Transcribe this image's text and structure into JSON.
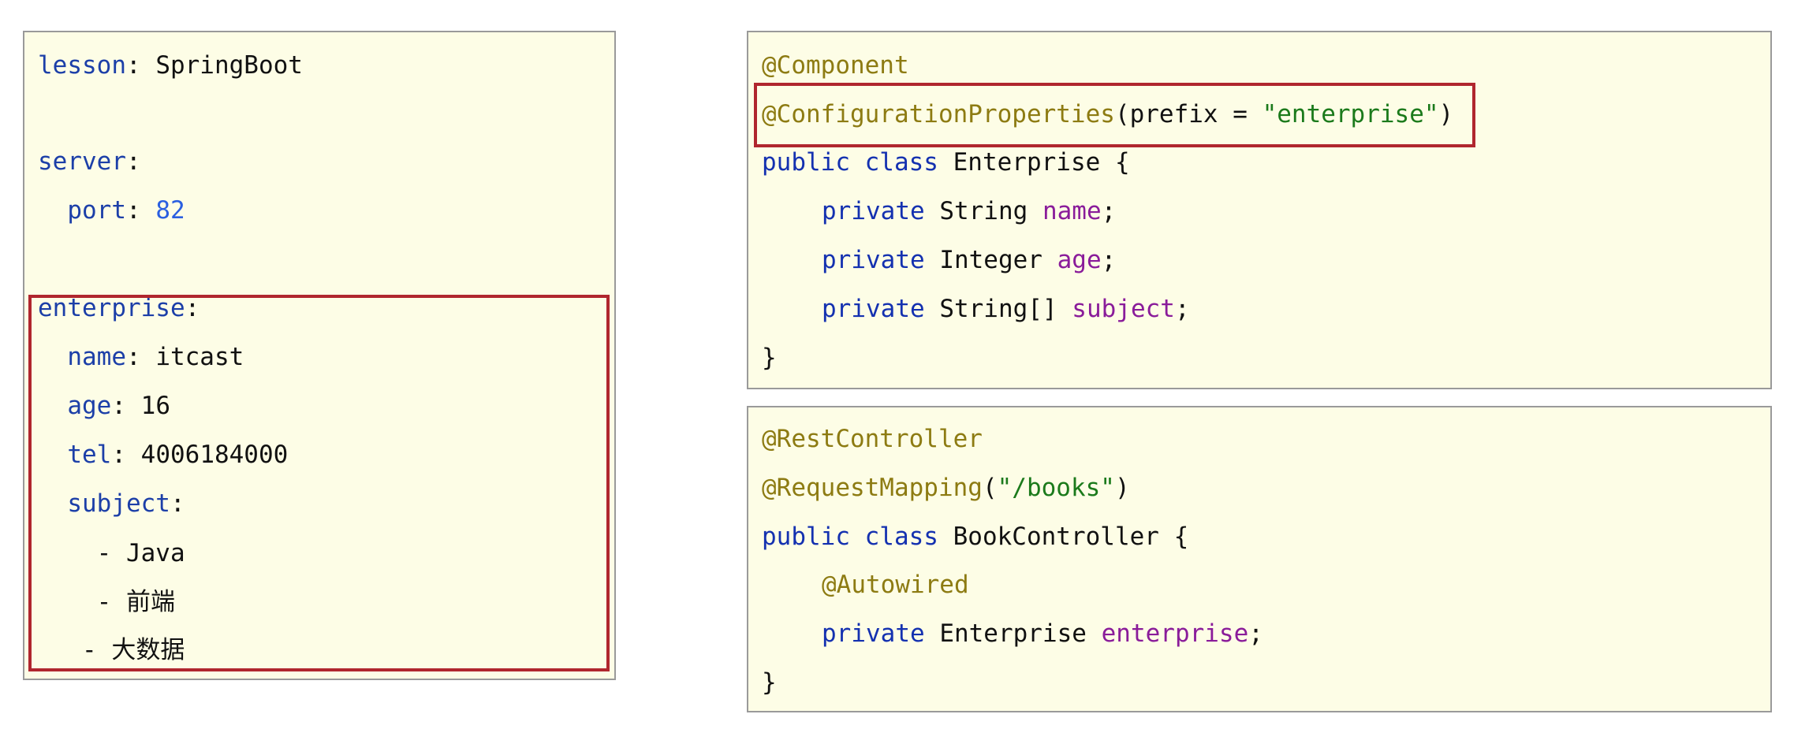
{
  "yaml_panel": {
    "lines": [
      {
        "key": "lesson",
        "colon": ":",
        "value": " SpringBoot"
      },
      {
        "key": "server",
        "colon": ":"
      },
      {
        "indent": "  ",
        "key": "port",
        "colon": ":",
        "value": " 82"
      },
      {
        "key": "enterprise",
        "colon": ":"
      },
      {
        "indent": "  ",
        "key": "name",
        "colon": ":",
        "value": " itcast"
      },
      {
        "indent": "  ",
        "key": "age",
        "colon": ":",
        "value": " 16"
      },
      {
        "indent": "  ",
        "key": "tel",
        "colon": ":",
        "value": " 4006184000"
      },
      {
        "indent": "  ",
        "key": "subject",
        "colon": ":"
      },
      {
        "indent": "    ",
        "dash": "- ",
        "value": "Java"
      },
      {
        "indent": "    ",
        "dash": "- ",
        "value": "前端"
      },
      {
        "indent": "   ",
        "dash": "- ",
        "value": "大数据"
      }
    ]
  },
  "enterprise_class_panel": {
    "annotation_component": "@Component",
    "annotation_config": "@ConfigurationProperties",
    "config_open": "(prefix = ",
    "config_value": "\"enterprise\"",
    "config_close": ")",
    "kw_public": "public",
    "kw_class": " class ",
    "class_name": "Enterprise {",
    "kw_private": "private",
    "fields": [
      {
        "type": " String ",
        "name": "name",
        "end": ";"
      },
      {
        "type": " Integer ",
        "name": "age",
        "end": ";"
      },
      {
        "type": " String[] ",
        "name": "subject",
        "end": ";"
      }
    ],
    "close_brace": "}"
  },
  "controller_panel": {
    "annotation_rest": "@RestController",
    "annotation_mapping": "@RequestMapping",
    "mapping_open": "(",
    "mapping_value": "\"/books\"",
    "mapping_close": ")",
    "kw_public": "public",
    "kw_class": " class ",
    "class_name": "BookController {",
    "annotation_autowired": "@Autowired",
    "kw_private": "private",
    "field_type": " Enterprise ",
    "field_name": "enterprise",
    "field_end": ";",
    "close_brace": "}"
  }
}
